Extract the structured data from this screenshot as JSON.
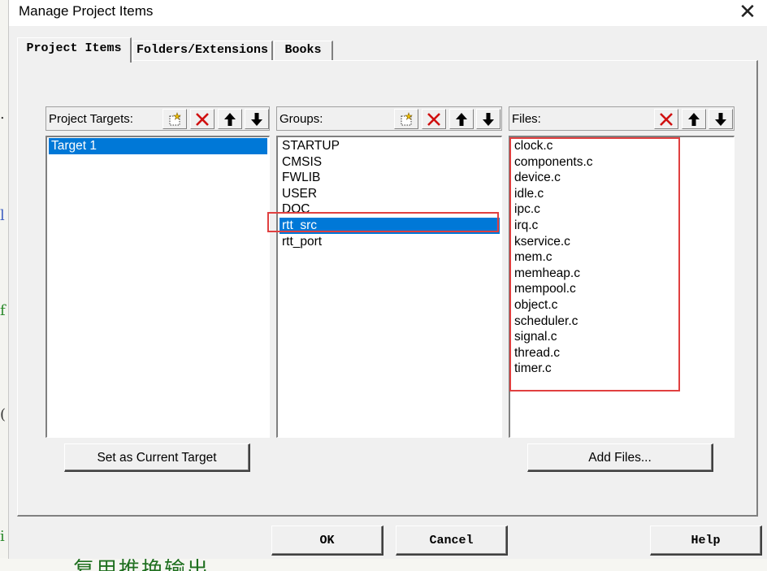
{
  "window": {
    "title": "Manage Project Items"
  },
  "tabs": [
    {
      "label": "Project Items",
      "active": true
    },
    {
      "label": "Folders/Extensions",
      "active": false
    },
    {
      "label": "Books",
      "active": false
    }
  ],
  "project_targets": {
    "label": "Project Targets:",
    "items": [
      "Target 1"
    ],
    "selected_index": 0
  },
  "groups": {
    "label": "Groups:",
    "items": [
      "STARTUP",
      "CMSIS",
      "FWLIB",
      "USER",
      "DOC",
      "rtt_src",
      "rtt_port"
    ],
    "selected_index": 5
  },
  "files": {
    "label": "Files:",
    "items": [
      "clock.c",
      "components.c",
      "device.c",
      "idle.c",
      "ipc.c",
      "irq.c",
      "kservice.c",
      "mem.c",
      "memheap.c",
      "mempool.c",
      "object.c",
      "scheduler.c",
      "signal.c",
      "thread.c",
      "timer.c"
    ]
  },
  "buttons": {
    "set_current_target": "Set as Current Target",
    "add_files": "Add Files...",
    "ok": "OK",
    "cancel": "Cancel",
    "help": "Help"
  },
  "background": {
    "bottom_text": "复用推挽输出"
  },
  "colors": {
    "selection": "#0078d7",
    "highlight_outline": "#e04040",
    "delete_icon": "#d01010"
  }
}
